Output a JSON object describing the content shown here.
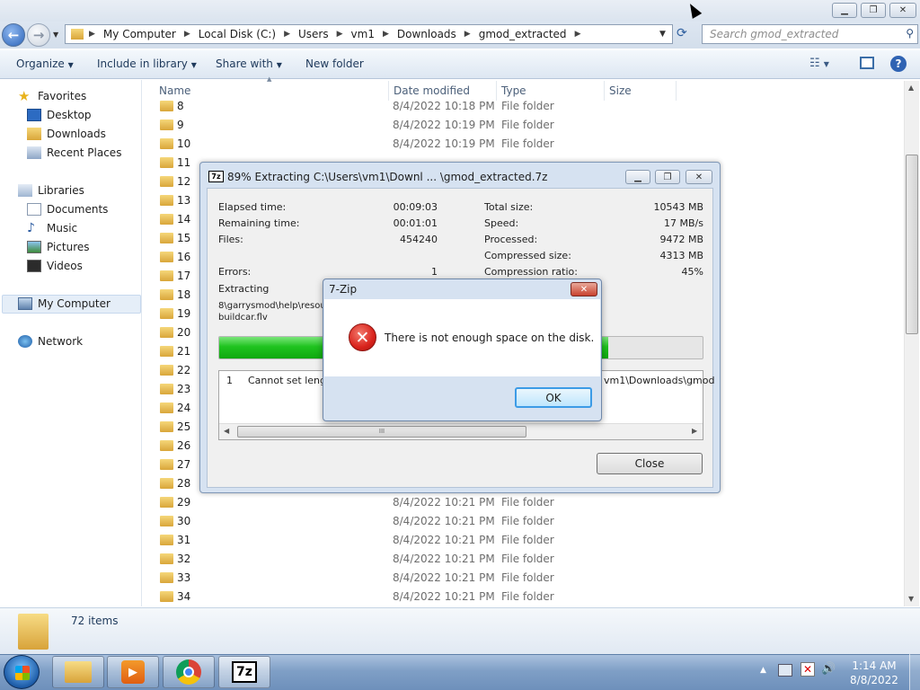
{
  "window": {
    "minimize": "▁",
    "restore": "❐",
    "close": "✕"
  },
  "nav": {
    "back_label": "←"
  },
  "address": {
    "crumbs": [
      "My Computer",
      "Local Disk (C:)",
      "Users",
      "vm1",
      "Downloads",
      "gmod_extracted"
    ],
    "search_placeholder": "Search gmod_extracted"
  },
  "toolbar": {
    "organize": "Organize",
    "include": "Include in library",
    "share": "Share with",
    "new_folder": "New folder"
  },
  "sidebar": {
    "favorites": "Favorites",
    "desktop": "Desktop",
    "downloads": "Downloads",
    "recent": "Recent Places",
    "libraries": "Libraries",
    "documents": "Documents",
    "music": "Music",
    "pictures": "Pictures",
    "videos": "Videos",
    "computer": "My Computer",
    "network": "Network"
  },
  "columns": {
    "name": "Name",
    "date": "Date modified",
    "type": "Type",
    "size": "Size"
  },
  "files": [
    {
      "name": "8",
      "date": "8/4/2022 10:18 PM",
      "type": "File folder"
    },
    {
      "name": "9",
      "date": "8/4/2022 10:19 PM",
      "type": "File folder"
    },
    {
      "name": "10",
      "date": "8/4/2022 10:19 PM",
      "type": "File folder"
    },
    {
      "name": "11",
      "date": "",
      "type": ""
    },
    {
      "name": "12",
      "date": "",
      "type": ""
    },
    {
      "name": "13",
      "date": "",
      "type": ""
    },
    {
      "name": "14",
      "date": "",
      "type": ""
    },
    {
      "name": "15",
      "date": "",
      "type": ""
    },
    {
      "name": "16",
      "date": "",
      "type": ""
    },
    {
      "name": "17",
      "date": "",
      "type": ""
    },
    {
      "name": "18",
      "date": "",
      "type": ""
    },
    {
      "name": "19",
      "date": "",
      "type": ""
    },
    {
      "name": "20",
      "date": "",
      "type": ""
    },
    {
      "name": "21",
      "date": "",
      "type": ""
    },
    {
      "name": "22",
      "date": "",
      "type": ""
    },
    {
      "name": "23",
      "date": "",
      "type": ""
    },
    {
      "name": "24",
      "date": "",
      "type": ""
    },
    {
      "name": "25",
      "date": "",
      "type": ""
    },
    {
      "name": "26",
      "date": "",
      "type": ""
    },
    {
      "name": "27",
      "date": "",
      "type": ""
    },
    {
      "name": "28",
      "date": "",
      "type": ""
    },
    {
      "name": "29",
      "date": "8/4/2022 10:21 PM",
      "type": "File folder"
    },
    {
      "name": "30",
      "date": "8/4/2022 10:21 PM",
      "type": "File folder"
    },
    {
      "name": "31",
      "date": "8/4/2022 10:21 PM",
      "type": "File folder"
    },
    {
      "name": "32",
      "date": "8/4/2022 10:21 PM",
      "type": "File folder"
    },
    {
      "name": "33",
      "date": "8/4/2022 10:21 PM",
      "type": "File folder"
    },
    {
      "name": "34",
      "date": "8/4/2022 10:21 PM",
      "type": "File folder"
    }
  ],
  "status": {
    "count": "72 items"
  },
  "extract": {
    "title": "89% Extracting C:\\Users\\vm1\\Downl ... \\gmod_extracted.7z",
    "app_icon": "7z",
    "elapsed_label": "Elapsed time:",
    "elapsed": "00:09:03",
    "remaining_label": "Remaining time:",
    "remaining": "00:01:01",
    "files_label": "Files:",
    "files": "454240",
    "errors_label": "Errors:",
    "errors": "1",
    "total_label": "Total size:",
    "total": "10543 MB",
    "speed_label": "Speed:",
    "speed": "17 MB/s",
    "processed_label": "Processed:",
    "processed": "9472 MB",
    "compressed_label": "Compressed size:",
    "compressed": "4313 MB",
    "ratio_label": "Compression ratio:",
    "ratio": "45%",
    "extracting_label": "Extracting",
    "current_file_1": "8\\garrysmod\\help\\resour",
    "current_file_2": "buildcar.flv",
    "progress": 0.89,
    "log_index": "1",
    "log_text": "Cannot set length",
    "log_path": "vm1\\Downloads\\gmod",
    "scroll_grip": "III",
    "close_label": "Close"
  },
  "error": {
    "title": "7-Zip",
    "message": "There is not enough space on the disk.",
    "ok_label": "OK"
  },
  "clock": {
    "time": "1:14 AM",
    "date": "8/8/2022"
  },
  "colors": {
    "accent": "#3399ff",
    "progress": "#1fc31f",
    "error_red": "#d9231c"
  }
}
